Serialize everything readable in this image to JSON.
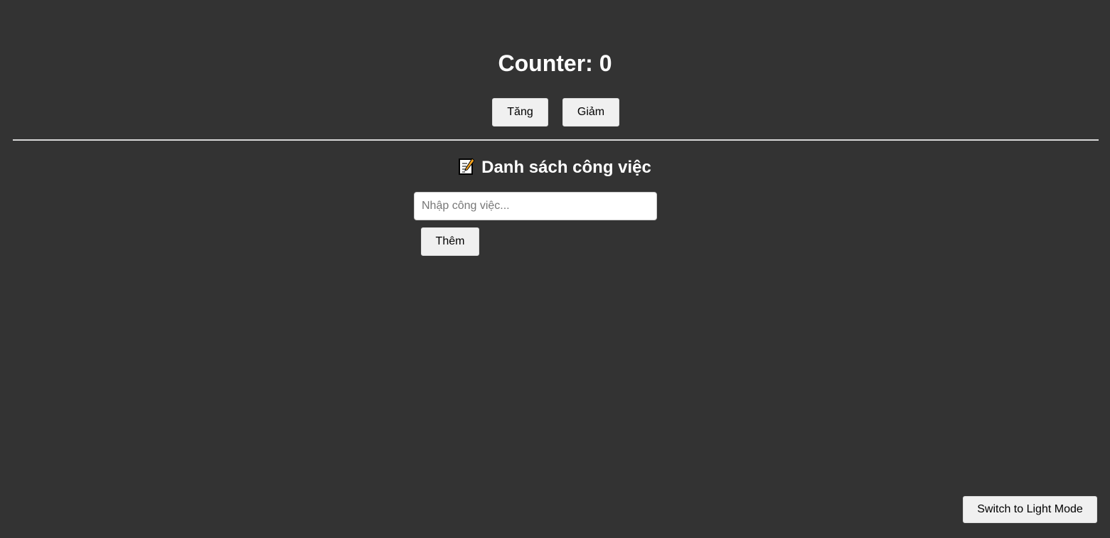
{
  "counter": {
    "title": "Counter: 0",
    "increase_label": "Tăng",
    "decrease_label": "Giảm"
  },
  "todo": {
    "title": "Danh sách công việc",
    "title_icon": "memo-icon",
    "input_placeholder": "Nhập công việc...",
    "input_value": "",
    "add_label": "Thêm"
  },
  "theme_toggle": {
    "label": "Switch to Light Mode"
  },
  "colors": {
    "background": "#333333",
    "text": "#ffffff",
    "button_bg": "#f0f0f0"
  }
}
